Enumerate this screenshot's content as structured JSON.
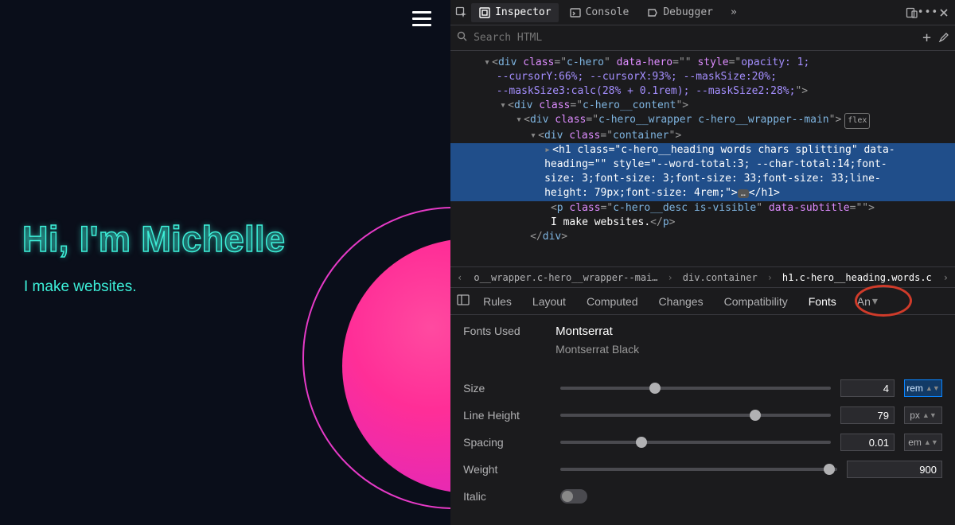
{
  "page": {
    "heading": "Hi, I'm Michelle",
    "desc": "I make websites."
  },
  "devtools": {
    "toolbar": {
      "inspector": "Inspector",
      "console": "Console",
      "debugger": "Debugger"
    },
    "search_placeholder": "Search HTML",
    "markup": {
      "l1a": "<div class=\"c-hero\" data-hero=\"\" style=\"opacity: 1;",
      "l1b": "--cursorY:66%; --cursorX:93%; --maskSize:20%;",
      "l1c": "--maskSize3:calc(28% + 0.1rem); --maskSize2:28%;\">",
      "l2": "<div class=\"c-hero__content\">",
      "l3": "<div class=\"c-hero__wrapper c-hero__wrapper--main\">",
      "l4": "<div class=\"container\">",
      "l5a": "<h1 class=\"c-hero__heading words chars splitting\" data-",
      "l5b": "heading=\"\" style=\"--word-total:3; --char-total:14;font-",
      "l5c": "size: 3;font-size: 3;font-size: 33;font-size: 33;line-",
      "l5d": "height: 79px;font-size: 4rem;\">…</h1>",
      "l6a": "<p class=\"c-hero__desc is-visible\" data-subtitle=\"\">",
      "l6b": "I make websites.</p>",
      "l7": "</div>"
    },
    "breadcrumbs": {
      "b1": "o__wrapper.c-hero__wrapper--mai…",
      "b2": "div.container",
      "b3": "h1.c-hero__heading.words.c"
    },
    "subtabs": {
      "rules": "Rules",
      "layout": "Layout",
      "computed": "Computed",
      "changes": "Changes",
      "compatibility": "Compatibility",
      "fonts": "Fonts",
      "an": "An"
    },
    "fonts": {
      "used_label": "Fonts Used",
      "family": "Montserrat",
      "face": "Montserrat Black",
      "size_label": "Size",
      "size_val": "4",
      "size_unit": "rem",
      "lh_label": "Line Height",
      "lh_val": "79",
      "lh_unit": "px",
      "sp_label": "Spacing",
      "sp_val": "0.01",
      "sp_unit": "em",
      "wt_label": "Weight",
      "wt_val": "900",
      "it_label": "Italic"
    }
  }
}
